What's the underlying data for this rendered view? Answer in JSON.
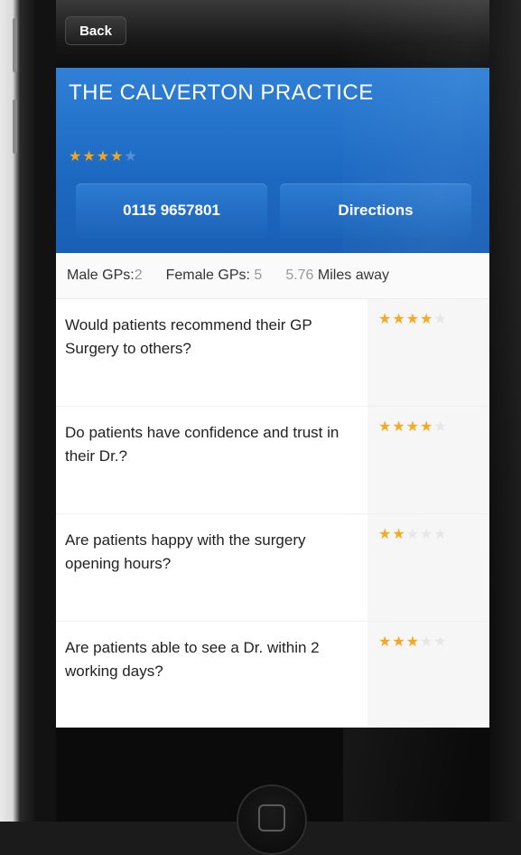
{
  "nav": {
    "back_label": "Back"
  },
  "practice": {
    "name": "THE CALVERTON PRACTICE",
    "address": "",
    "rating": 3.5,
    "phone": "0115 9657801",
    "directions_label": "Directions"
  },
  "stats": {
    "male_label": "Male GPs:",
    "male_value": "2",
    "female_label": "Female GPs:",
    "female_value": "5",
    "distance_value": "5.76",
    "distance_label": "Miles away"
  },
  "questions": [
    {
      "text": "Would patients recommend their GP Surgery to others?",
      "rating": 4,
      "responses": ""
    },
    {
      "text": "Do patients have confidence and trust in their Dr.?",
      "rating": 3.5,
      "responses": ""
    },
    {
      "text": "Are patients happy with the surgery opening hours?",
      "rating": 2,
      "responses": ""
    },
    {
      "text": "Are patients able to see a Dr. within 2 working days?",
      "rating": 3,
      "responses": ""
    }
  ],
  "colors": {
    "header_blue": "#1d6ac3",
    "star": "#f5a51b"
  },
  "icons": {
    "star": "star-icon",
    "home": "home-button-icon"
  }
}
